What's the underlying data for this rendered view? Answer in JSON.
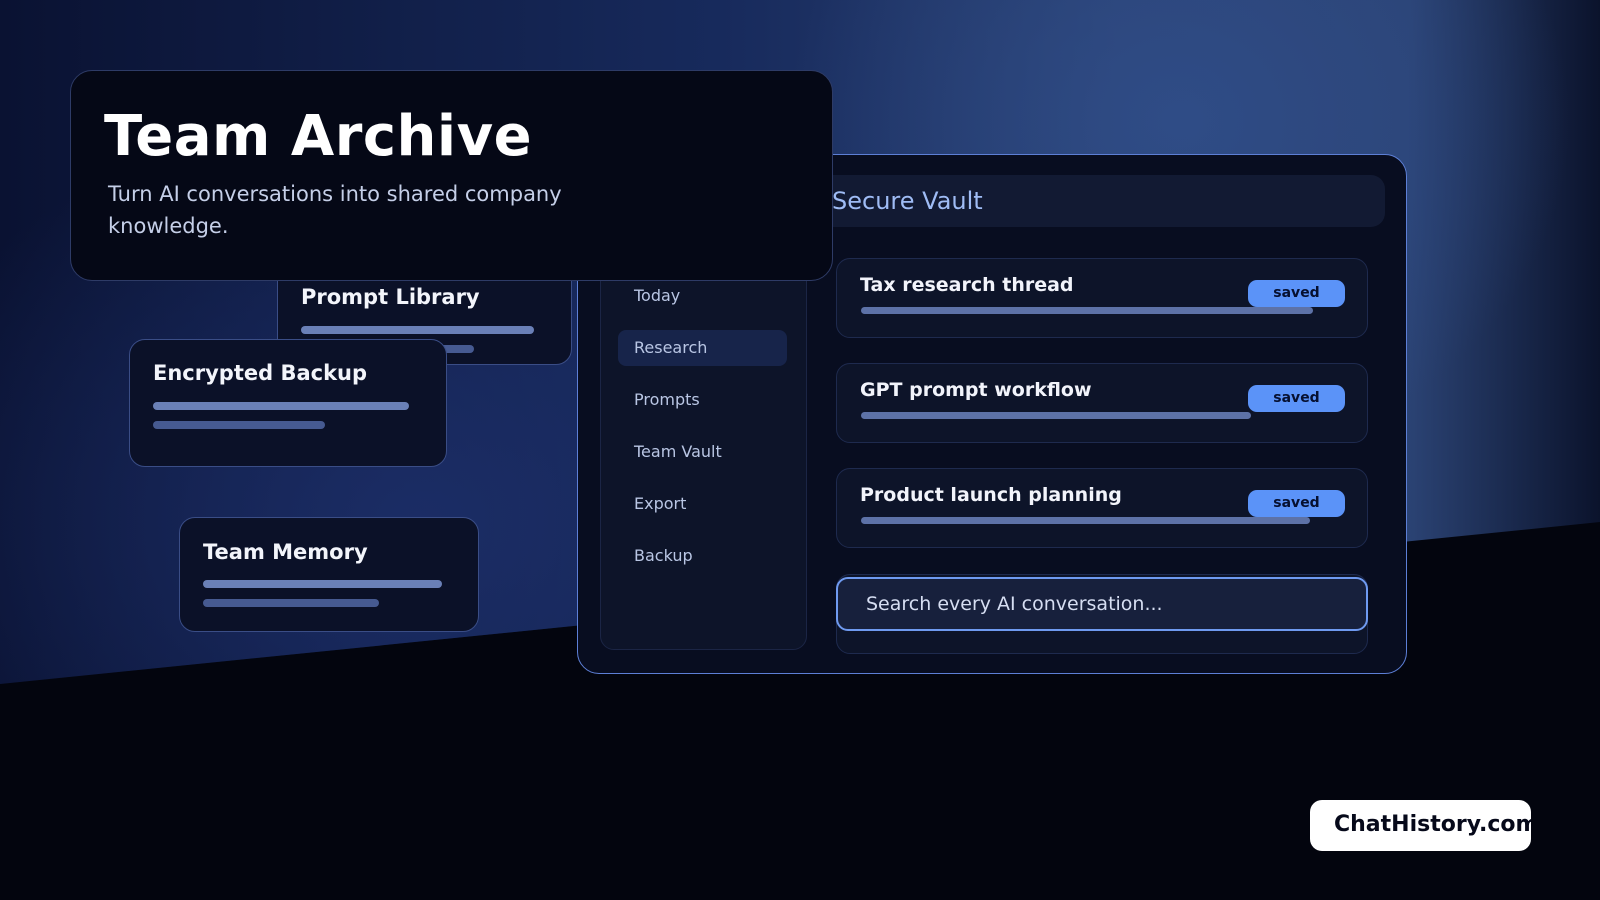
{
  "hero": {
    "title": "Team Archive",
    "subtitle": "Turn AI conversations into shared company knowledge."
  },
  "app": {
    "vault_title": "Secure Vault",
    "sidebar": {
      "items": [
        {
          "label": "Today",
          "active": false
        },
        {
          "label": "Research",
          "active": true
        },
        {
          "label": "Prompts",
          "active": false
        },
        {
          "label": "Team Vault",
          "active": false
        },
        {
          "label": "Export",
          "active": false
        },
        {
          "label": "Backup",
          "active": false
        }
      ]
    },
    "conversations": [
      {
        "title": "Tax research thread",
        "badge": "saved"
      },
      {
        "title": "GPT prompt workflow",
        "badge": "saved"
      },
      {
        "title": "Product launch planning",
        "badge": "saved"
      }
    ],
    "search": {
      "placeholder": "Search every AI conversation..."
    }
  },
  "features": [
    {
      "title": "Prompt Library"
    },
    {
      "title": "Encrypted Backup"
    },
    {
      "title": "Team Memory"
    }
  ],
  "brand": {
    "label": "ChatHistory.com"
  },
  "colors": {
    "accent": "#5b93f8",
    "panel_border": "#5d7fd6",
    "background_dark": "#03050e"
  }
}
